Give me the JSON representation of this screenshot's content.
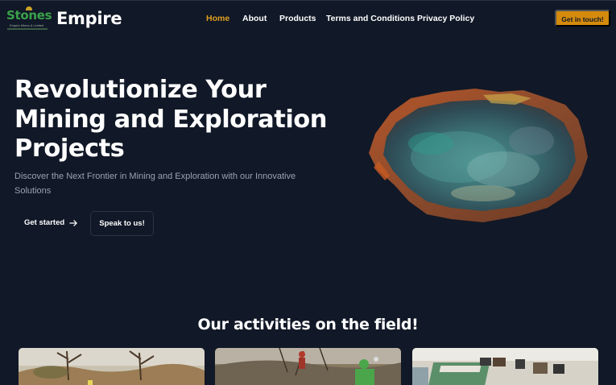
{
  "header": {
    "logo": {
      "word": "Stones",
      "tagline": "Empire Mines & Limited"
    },
    "brand": "Empire",
    "nav": [
      {
        "label": "Home",
        "active": true
      },
      {
        "label": "About",
        "active": false
      },
      {
        "label": "Products",
        "active": false
      },
      {
        "label": "Terms and Conditions",
        "active": false
      },
      {
        "label": "Privacy Policy",
        "active": false
      }
    ],
    "cta_label": "Get in touch!"
  },
  "hero": {
    "title_lines": [
      "Revolutionize Your",
      "Mining and Exploration",
      "Projects"
    ],
    "subtitle": "Discover the Next Frontier in Mining and Exploration with our Innovative Solutions",
    "primary_button": "Get started",
    "secondary_button": "Speak to us!"
  },
  "activities": {
    "title": "Our activities on the field!"
  },
  "colors": {
    "background": "#111827",
    "accent": "#d48a0c",
    "nav_active": "#e0a020",
    "logo_green": "#3aa14a",
    "muted_text": "#9aa3b2"
  }
}
